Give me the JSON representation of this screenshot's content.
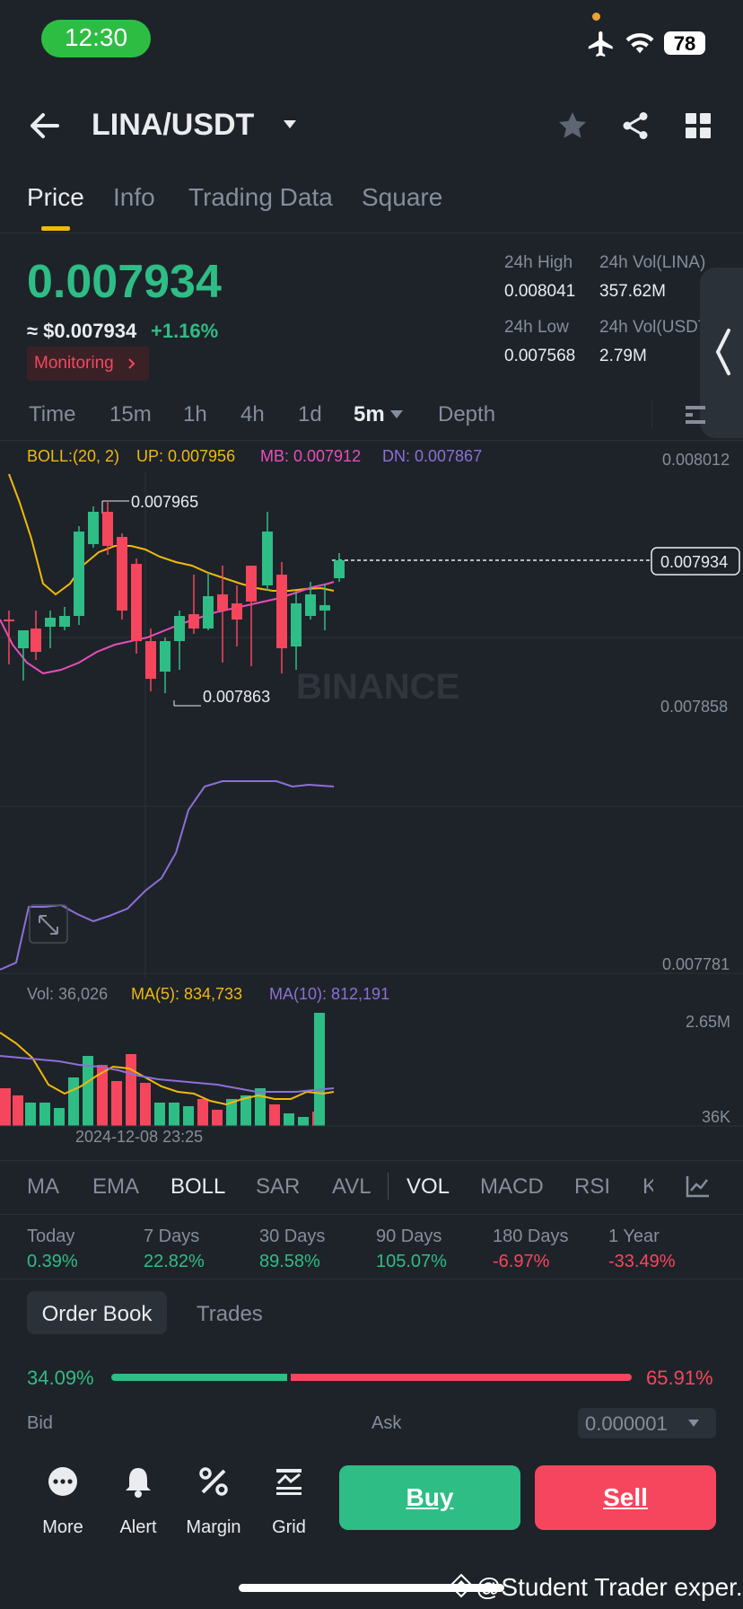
{
  "status_bar": {
    "time": "12:30",
    "battery": "78"
  },
  "header": {
    "pair": "LINA/USDT"
  },
  "tabs": [
    "Price",
    "Info",
    "Trading Data",
    "Square"
  ],
  "price": {
    "last": "0.007934",
    "usd": "≈ $0.007934",
    "change": "+1.16%",
    "monitoring": "Monitoring"
  },
  "stats": {
    "high_label": "24h High",
    "high": "0.008041",
    "vol_lina_label": "24h Vol(LINA)",
    "vol_lina": "357.62M",
    "low_label": "24h Low",
    "low": "0.007568",
    "vol_usdt_label": "24h Vol(USDT)",
    "vol_usdt": "2.79M"
  },
  "timeframes": [
    "Time",
    "15m",
    "1h",
    "4h",
    "1d",
    "5m",
    "Depth"
  ],
  "boll": {
    "label": "BOLL:(20, 2)",
    "up": "UP: 0.007956",
    "mb": "MB: 0.007912",
    "dn": "DN: 0.007867"
  },
  "price_axis": {
    "top": "0.008012",
    "current": "0.007934",
    "mid": "0.007858",
    "bottom": "0.007781"
  },
  "chart_labels": {
    "high_mark": "0.007965",
    "low_mark": "0.007863",
    "watermark": "BINANCE"
  },
  "volume": {
    "vol": "Vol: 36,026",
    "ma5": "MA(5): 834,733",
    "ma10": "MA(10): 812,191",
    "axis_top": "2.65M",
    "axis_bottom": "36K",
    "time": "2024-12-08 23:25"
  },
  "indicators": [
    "MA",
    "EMA",
    "BOLL",
    "SAR",
    "AVL",
    "VOL",
    "MACD",
    "RSI",
    "K"
  ],
  "performance": [
    {
      "label": "Today",
      "value": "0.39%"
    },
    {
      "label": "7 Days",
      "value": "22.82%"
    },
    {
      "label": "30 Days",
      "value": "89.58%"
    },
    {
      "label": "90 Days",
      "value": "105.07%"
    },
    {
      "label": "180 Days",
      "value": "-6.97%"
    },
    {
      "label": "1 Year",
      "value": "-33.49%"
    }
  ],
  "orderbook": {
    "tab1": "Order Book",
    "tab2": "Trades",
    "bid_pct": "34.09%",
    "ask_pct": "65.91%",
    "bid_fraction": 0.3409,
    "bid": "Bid",
    "ask": "Ask",
    "precision": "0.000001"
  },
  "bottom": {
    "more": "More",
    "alert": "Alert",
    "margin": "Margin",
    "grid": "Grid",
    "buy": "Buy",
    "sell": "Sell"
  },
  "watermark": "@Student Trader exper...",
  "colors": {
    "green": "#2ebd85",
    "red": "#f6465d",
    "bg": "#1e2329",
    "boll_up": "#f0b90b",
    "boll_mb": "#e94dbd",
    "boll_dn": "#8c6fd9"
  }
}
